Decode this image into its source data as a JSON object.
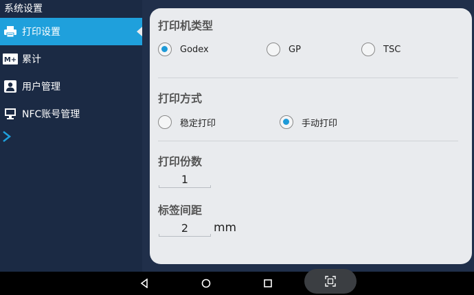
{
  "sidebar": {
    "title": "系统设置",
    "items": [
      {
        "label": "打印设置",
        "icon": "printer-icon",
        "active": true
      },
      {
        "label": "累计",
        "icon": "memory-plus-icon",
        "active": false
      },
      {
        "label": "用户管理",
        "icon": "user-icon",
        "active": false
      },
      {
        "label": "NFC账号管理",
        "icon": "monitor-icon",
        "active": false
      }
    ],
    "expand_icon": "chevron-right-icon"
  },
  "printer_type": {
    "title": "打印机类型",
    "options": [
      {
        "label": "Godex",
        "checked": true
      },
      {
        "label": "GP",
        "checked": false
      },
      {
        "label": "TSC",
        "checked": false
      }
    ]
  },
  "print_mode": {
    "title": "打印方式",
    "options": [
      {
        "label": "稳定打印",
        "checked": false
      },
      {
        "label": "手动打印",
        "checked": true
      }
    ]
  },
  "copies": {
    "title": "打印份数",
    "value": "1"
  },
  "label_gap": {
    "title": "标签间距",
    "value": "2",
    "unit": "mm"
  },
  "navbar": {
    "icons": [
      "back-icon",
      "home-icon",
      "recents-icon",
      "screenshot-icon"
    ]
  },
  "colors": {
    "accent": "#1fa0dc",
    "sidebar_bg": "#1b2a44",
    "panel_bg": "#e9ebee",
    "radio_checked": "#1e9ad8"
  }
}
